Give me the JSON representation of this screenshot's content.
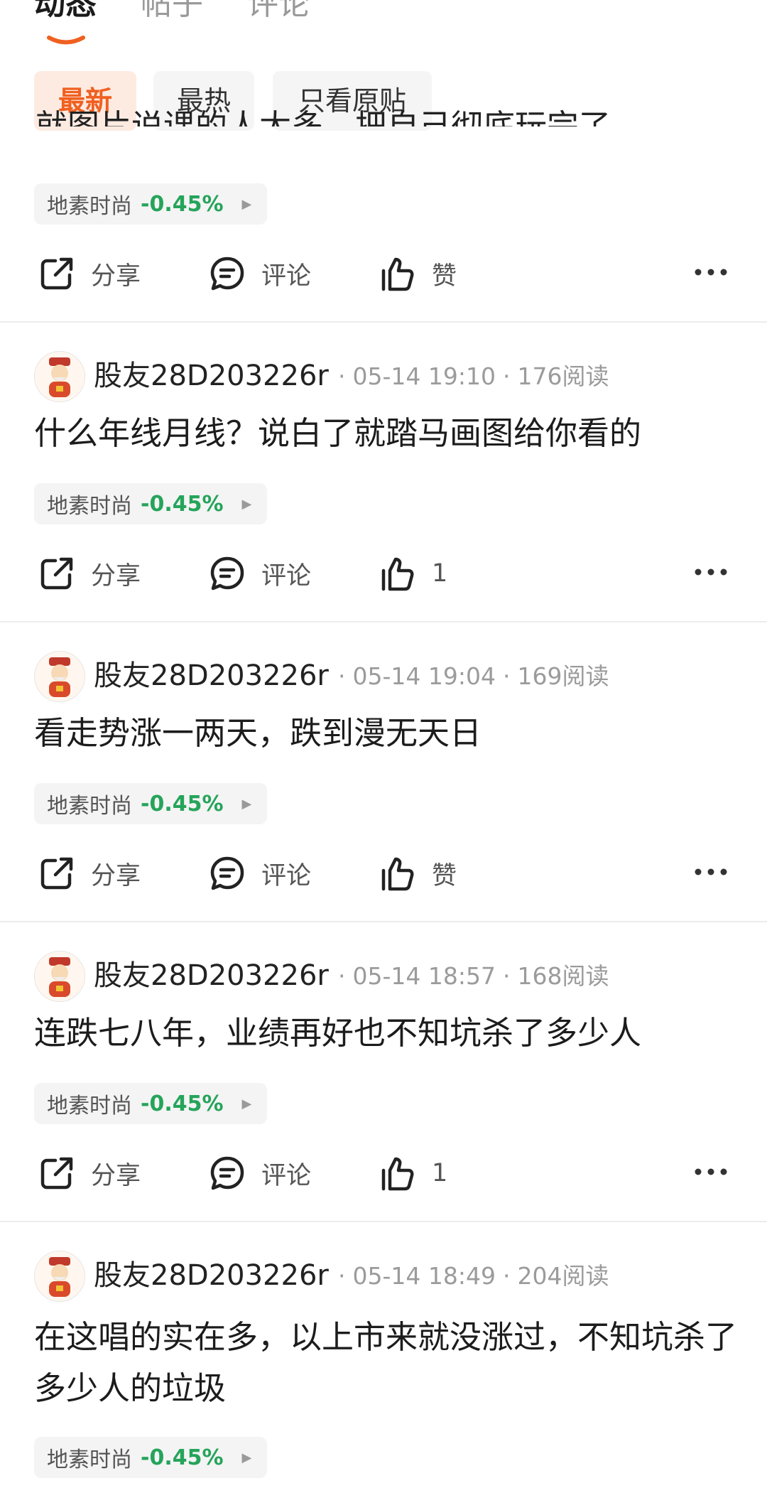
{
  "tabs": [
    {
      "label": "动态",
      "active": true
    },
    {
      "label": "帖子",
      "active": false
    },
    {
      "label": "评论",
      "active": false
    }
  ],
  "filters": [
    {
      "label": "最新",
      "active": true
    },
    {
      "label": "最热",
      "active": false
    },
    {
      "label": "只看原贴",
      "active": false
    }
  ],
  "partial_post": {
    "clipped_text": "就图片说课的人太多，把自己彻底玩完了，",
    "stock": {
      "name": "地素时尚",
      "change": "-0.45%"
    },
    "actions": {
      "share": "分享",
      "comment": "评论",
      "like": "赞"
    }
  },
  "posts": [
    {
      "username": "股友28D203226r",
      "time": "05-14 19:10",
      "reads": "176阅读",
      "content": "什么年线月线？说白了就踏马画图给你看的",
      "stock": {
        "name": "地素时尚",
        "change": "-0.45%"
      },
      "actions": {
        "share": "分享",
        "comment": "评论",
        "like": "1"
      }
    },
    {
      "username": "股友28D203226r",
      "time": "05-14 19:04",
      "reads": "169阅读",
      "content": "看走势涨一两天，跌到漫无天日",
      "stock": {
        "name": "地素时尚",
        "change": "-0.45%"
      },
      "actions": {
        "share": "分享",
        "comment": "评论",
        "like": "赞"
      }
    },
    {
      "username": "股友28D203226r",
      "time": "05-14 18:57",
      "reads": "168阅读",
      "content": "连跌七八年，业绩再好也不知坑杀了多少人",
      "stock": {
        "name": "地素时尚",
        "change": "-0.45%"
      },
      "actions": {
        "share": "分享",
        "comment": "评论",
        "like": "1"
      }
    },
    {
      "username": "股友28D203226r",
      "time": "05-14 18:49",
      "reads": "204阅读",
      "content": "在这唱的实在多，以上市来就没涨过，不知坑杀了多少人的垃圾",
      "stock": {
        "name": "地素时尚",
        "change": "-0.45%"
      }
    }
  ],
  "colors": {
    "accent": "#f06020",
    "filter_active_bg": "#fdebe2",
    "stock_change": "#25a45a",
    "divider": "#ececec"
  },
  "icons": {
    "share": "share-icon",
    "comment": "comment-icon",
    "like": "thumbs-up-icon",
    "more": "more-dots-icon",
    "avatar": "caishen-avatar"
  }
}
